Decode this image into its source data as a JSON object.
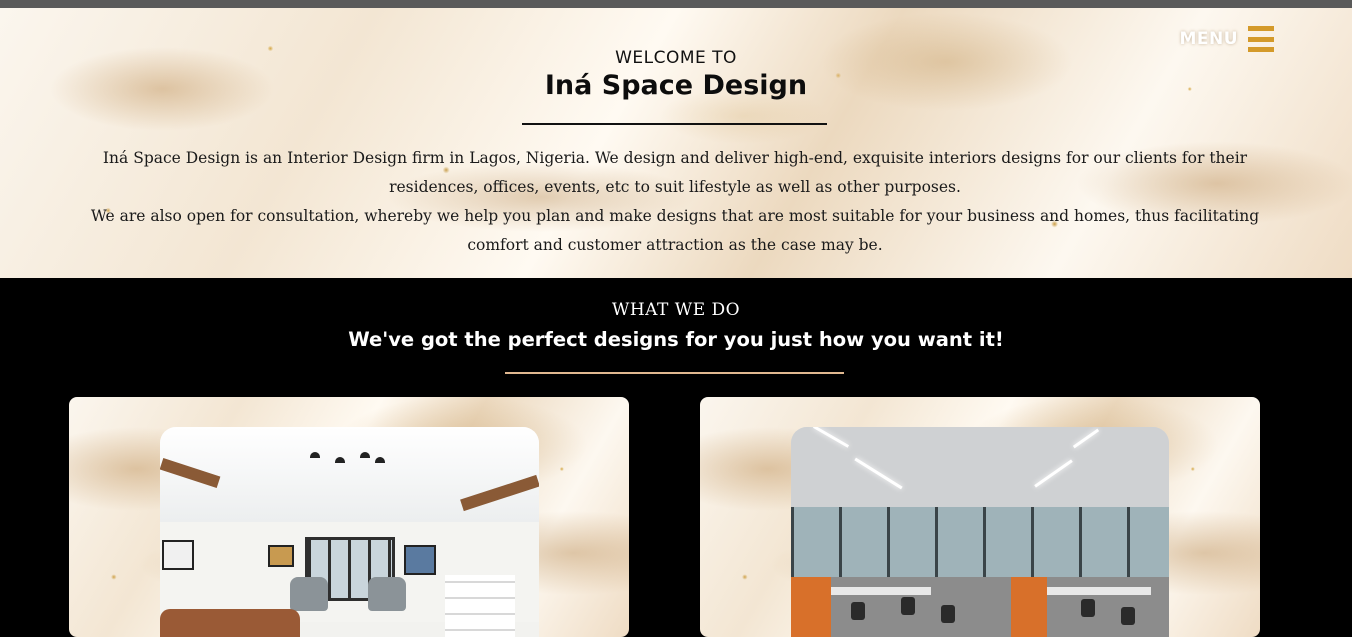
{
  "header": {
    "menu_label": "MENU",
    "welcome": "WELCOME TO",
    "brand": "Iná Space Design",
    "intro_p1": "Iná Space Design is an Interior Design firm in Lagos, Nigeria. We design and deliver high-end, exquisite interiors designs for our clients for their residences, offices, events, etc to suit lifestyle as well as other purposes.",
    "intro_p2": "We are also open for consultation, whereby we help you plan and make designs that are most suitable for your business and homes, thus facilitating comfort and customer attraction as the case may be."
  },
  "services": {
    "heading": "WHAT WE DO",
    "tagline": "We've got the perfect designs for you just how you want it!"
  },
  "colors": {
    "accent_gold": "#d49a2a",
    "divider_peach": "#e0b890",
    "section_bg": "#000000"
  },
  "icons": {
    "menu": "hamburger-icon"
  }
}
